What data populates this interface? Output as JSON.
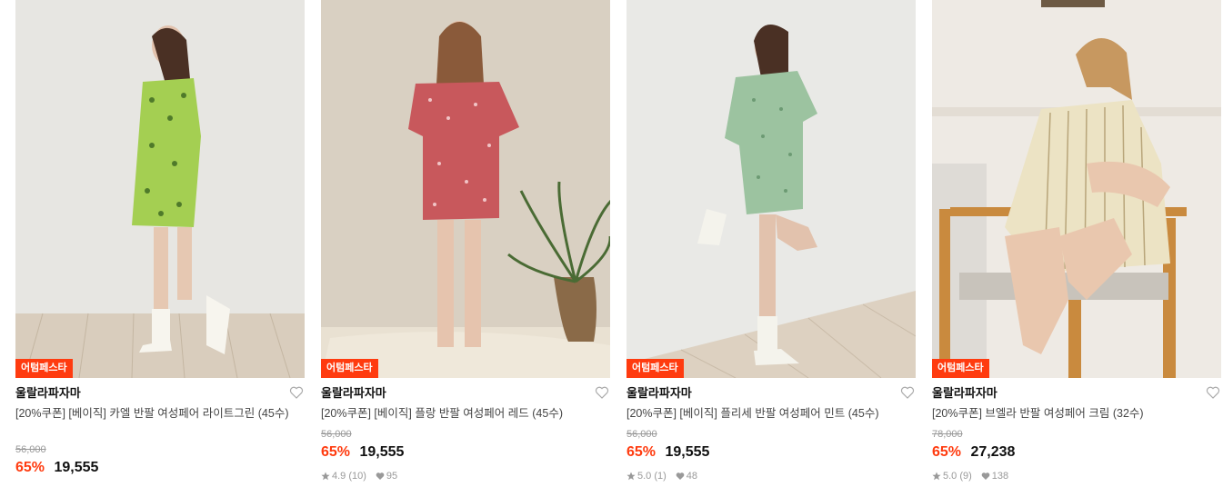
{
  "colors": {
    "accent": "#ff3b0f",
    "brand_text": "#111111",
    "muted": "#999999"
  },
  "products": [
    {
      "badge": "어텀페스타",
      "brand": "울랄라파자마",
      "title": "[20%쿠폰] [베이직] 카엘 반팔 여성페어 라이트그린 (45수)",
      "original_price": "56,000",
      "discount_rate": "65%",
      "price": "19,555",
      "rating": "",
      "likes": "",
      "garment_color": "#a4cf52"
    },
    {
      "badge": "어텀페스타",
      "brand": "울랄라파자마",
      "title": "[20%쿠폰] [베이직] 플랑 반팔 여성페어 레드 (45수)",
      "original_price": "56,000",
      "discount_rate": "65%",
      "price": "19,555",
      "rating": "4.9 (10)",
      "likes": "95",
      "garment_color": "#c8585c"
    },
    {
      "badge": "어텀페스타",
      "brand": "울랄라파자마",
      "title": "[20%쿠폰] [베이직] 플리세 반팔 여성페어 민트 (45수)",
      "original_price": "56,000",
      "discount_rate": "65%",
      "price": "19,555",
      "rating": "5.0 (1)",
      "likes": "48",
      "garment_color": "#9cc3a0"
    },
    {
      "badge": "어텀페스타",
      "brand": "울랄라파자마",
      "title": "[20%쿠폰] 브엘라 반팔 여성페어 크림 (32수)",
      "original_price": "78,000",
      "discount_rate": "65%",
      "price": "27,238",
      "rating": "5.0 (9)",
      "likes": "138",
      "garment_color": "#ece3c4"
    }
  ]
}
